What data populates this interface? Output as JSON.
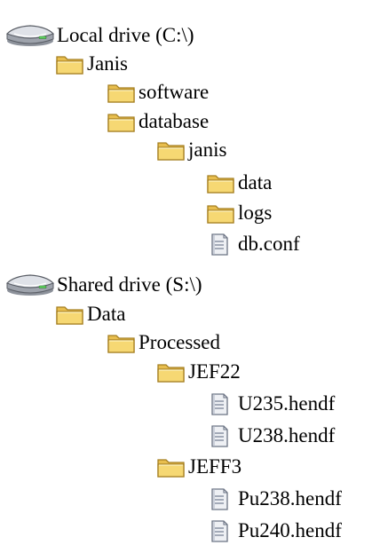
{
  "tree": {
    "local_drive": {
      "label": "Local drive (C:\\)",
      "icon": "drive-icon",
      "janis": {
        "label": "Janis",
        "icon": "folder-icon",
        "software": {
          "label": "software",
          "icon": "folder-icon"
        },
        "database": {
          "label": "database",
          "icon": "folder-icon",
          "janis": {
            "label": "janis",
            "icon": "folder-icon",
            "data": {
              "label": "data",
              "icon": "folder-icon"
            },
            "logs": {
              "label": "logs",
              "icon": "folder-icon"
            },
            "db_conf": {
              "label": "db.conf",
              "icon": "file-icon"
            }
          }
        }
      }
    },
    "shared_drive": {
      "label": "Shared drive (S:\\)",
      "icon": "drive-icon",
      "data": {
        "label": "Data",
        "icon": "folder-icon",
        "processed": {
          "label": "Processed",
          "icon": "folder-icon",
          "jef22": {
            "label": "JEF22",
            "icon": "folder-icon",
            "u235": {
              "label": "U235.hendf",
              "icon": "file-icon"
            },
            "u238": {
              "label": "U238.hendf",
              "icon": "file-icon"
            }
          },
          "jeff3": {
            "label": "JEFF3",
            "icon": "folder-icon",
            "pu238": {
              "label": "Pu238.hendf",
              "icon": "file-icon"
            },
            "pu240": {
              "label": "Pu240.hendf",
              "icon": "file-icon"
            }
          }
        }
      }
    }
  },
  "colors": {
    "folder_fill": "#f6d873",
    "folder_tab": "#e8be4e",
    "folder_outline": "#a57f22",
    "drive_body": "#c9ccd3",
    "drive_outline": "#5a5e66",
    "file_fill": "#eef0f4",
    "file_outline": "#6b7383"
  }
}
